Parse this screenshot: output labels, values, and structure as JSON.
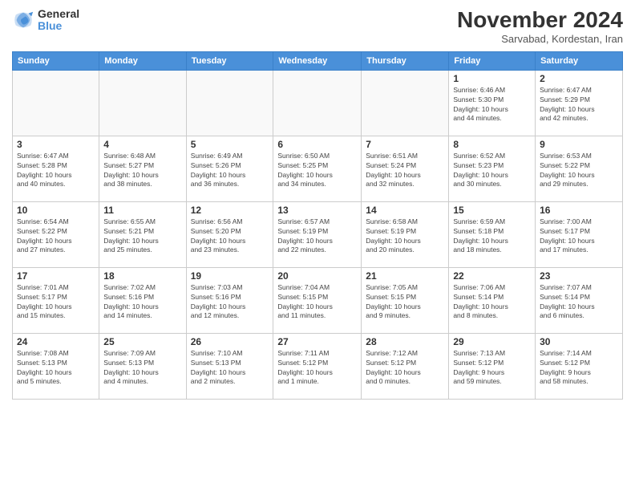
{
  "logo": {
    "general": "General",
    "blue": "Blue"
  },
  "title": "November 2024",
  "subtitle": "Sarvabad, Kordestan, Iran",
  "headers": [
    "Sunday",
    "Monday",
    "Tuesday",
    "Wednesday",
    "Thursday",
    "Friday",
    "Saturday"
  ],
  "weeks": [
    [
      {
        "day": "",
        "info": ""
      },
      {
        "day": "",
        "info": ""
      },
      {
        "day": "",
        "info": ""
      },
      {
        "day": "",
        "info": ""
      },
      {
        "day": "",
        "info": ""
      },
      {
        "day": "1",
        "info": "Sunrise: 6:46 AM\nSunset: 5:30 PM\nDaylight: 10 hours\nand 44 minutes."
      },
      {
        "day": "2",
        "info": "Sunrise: 6:47 AM\nSunset: 5:29 PM\nDaylight: 10 hours\nand 42 minutes."
      }
    ],
    [
      {
        "day": "3",
        "info": "Sunrise: 6:47 AM\nSunset: 5:28 PM\nDaylight: 10 hours\nand 40 minutes."
      },
      {
        "day": "4",
        "info": "Sunrise: 6:48 AM\nSunset: 5:27 PM\nDaylight: 10 hours\nand 38 minutes."
      },
      {
        "day": "5",
        "info": "Sunrise: 6:49 AM\nSunset: 5:26 PM\nDaylight: 10 hours\nand 36 minutes."
      },
      {
        "day": "6",
        "info": "Sunrise: 6:50 AM\nSunset: 5:25 PM\nDaylight: 10 hours\nand 34 minutes."
      },
      {
        "day": "7",
        "info": "Sunrise: 6:51 AM\nSunset: 5:24 PM\nDaylight: 10 hours\nand 32 minutes."
      },
      {
        "day": "8",
        "info": "Sunrise: 6:52 AM\nSunset: 5:23 PM\nDaylight: 10 hours\nand 30 minutes."
      },
      {
        "day": "9",
        "info": "Sunrise: 6:53 AM\nSunset: 5:22 PM\nDaylight: 10 hours\nand 29 minutes."
      }
    ],
    [
      {
        "day": "10",
        "info": "Sunrise: 6:54 AM\nSunset: 5:22 PM\nDaylight: 10 hours\nand 27 minutes."
      },
      {
        "day": "11",
        "info": "Sunrise: 6:55 AM\nSunset: 5:21 PM\nDaylight: 10 hours\nand 25 minutes."
      },
      {
        "day": "12",
        "info": "Sunrise: 6:56 AM\nSunset: 5:20 PM\nDaylight: 10 hours\nand 23 minutes."
      },
      {
        "day": "13",
        "info": "Sunrise: 6:57 AM\nSunset: 5:19 PM\nDaylight: 10 hours\nand 22 minutes."
      },
      {
        "day": "14",
        "info": "Sunrise: 6:58 AM\nSunset: 5:19 PM\nDaylight: 10 hours\nand 20 minutes."
      },
      {
        "day": "15",
        "info": "Sunrise: 6:59 AM\nSunset: 5:18 PM\nDaylight: 10 hours\nand 18 minutes."
      },
      {
        "day": "16",
        "info": "Sunrise: 7:00 AM\nSunset: 5:17 PM\nDaylight: 10 hours\nand 17 minutes."
      }
    ],
    [
      {
        "day": "17",
        "info": "Sunrise: 7:01 AM\nSunset: 5:17 PM\nDaylight: 10 hours\nand 15 minutes."
      },
      {
        "day": "18",
        "info": "Sunrise: 7:02 AM\nSunset: 5:16 PM\nDaylight: 10 hours\nand 14 minutes."
      },
      {
        "day": "19",
        "info": "Sunrise: 7:03 AM\nSunset: 5:16 PM\nDaylight: 10 hours\nand 12 minutes."
      },
      {
        "day": "20",
        "info": "Sunrise: 7:04 AM\nSunset: 5:15 PM\nDaylight: 10 hours\nand 11 minutes."
      },
      {
        "day": "21",
        "info": "Sunrise: 7:05 AM\nSunset: 5:15 PM\nDaylight: 10 hours\nand 9 minutes."
      },
      {
        "day": "22",
        "info": "Sunrise: 7:06 AM\nSunset: 5:14 PM\nDaylight: 10 hours\nand 8 minutes."
      },
      {
        "day": "23",
        "info": "Sunrise: 7:07 AM\nSunset: 5:14 PM\nDaylight: 10 hours\nand 6 minutes."
      }
    ],
    [
      {
        "day": "24",
        "info": "Sunrise: 7:08 AM\nSunset: 5:13 PM\nDaylight: 10 hours\nand 5 minutes."
      },
      {
        "day": "25",
        "info": "Sunrise: 7:09 AM\nSunset: 5:13 PM\nDaylight: 10 hours\nand 4 minutes."
      },
      {
        "day": "26",
        "info": "Sunrise: 7:10 AM\nSunset: 5:13 PM\nDaylight: 10 hours\nand 2 minutes."
      },
      {
        "day": "27",
        "info": "Sunrise: 7:11 AM\nSunset: 5:12 PM\nDaylight: 10 hours\nand 1 minute."
      },
      {
        "day": "28",
        "info": "Sunrise: 7:12 AM\nSunset: 5:12 PM\nDaylight: 10 hours\nand 0 minutes."
      },
      {
        "day": "29",
        "info": "Sunrise: 7:13 AM\nSunset: 5:12 PM\nDaylight: 9 hours\nand 59 minutes."
      },
      {
        "day": "30",
        "info": "Sunrise: 7:14 AM\nSunset: 5:12 PM\nDaylight: 9 hours\nand 58 minutes."
      }
    ]
  ]
}
